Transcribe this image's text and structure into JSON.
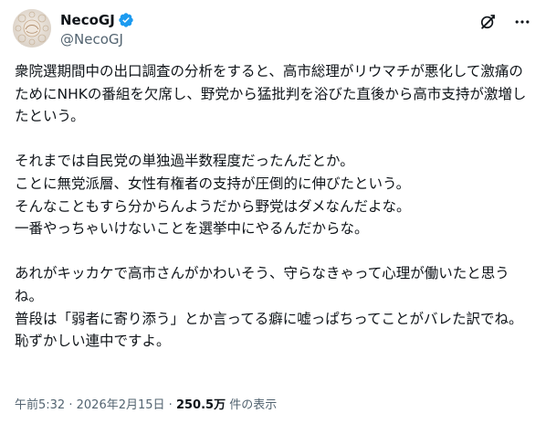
{
  "author": {
    "display_name": "NecoGJ",
    "handle": "@NecoGJ",
    "verified_icon": "verified-badge-icon",
    "avatar_icon": "floral-avatar-icon"
  },
  "header_actions": {
    "grok_icon": "grok-icon",
    "more_icon": "more-dots-icon"
  },
  "post": {
    "text": "衆院選期間中の出口調査の分析をすると、高市総理がリウマチが悪化して激痛のためにNHKの番組を欠席し、野党から猛批判を浴びた直後から高市支持が激増したという。\n\nそれまでは自民党の単独過半数程度だったんだとか。\nことに無党派層、女性有権者の支持が圧倒的に伸びたという。\nそんなこともすら分からんようだから野党はダメなんだよな。\n一番やっちゃいけないことを選挙中にやるんだからな。\n\nあれがキッカケで高市さんがかわいそう、守らなきゃって心理が働いたと思うね。\n普段は「弱者に寄り添う」とか言ってる癖に嘘っぱちってことがバレた訳でね。\n恥ずかしい連中ですよ。"
  },
  "meta": {
    "time": "午前5:32",
    "separator1": "·",
    "date": "2026年2月15日",
    "separator2": "·",
    "views": "250.5万",
    "views_label": "件の表示"
  },
  "colors": {
    "text": "#0f1419",
    "secondary": "#536471",
    "verified": "#1d9bf0"
  }
}
